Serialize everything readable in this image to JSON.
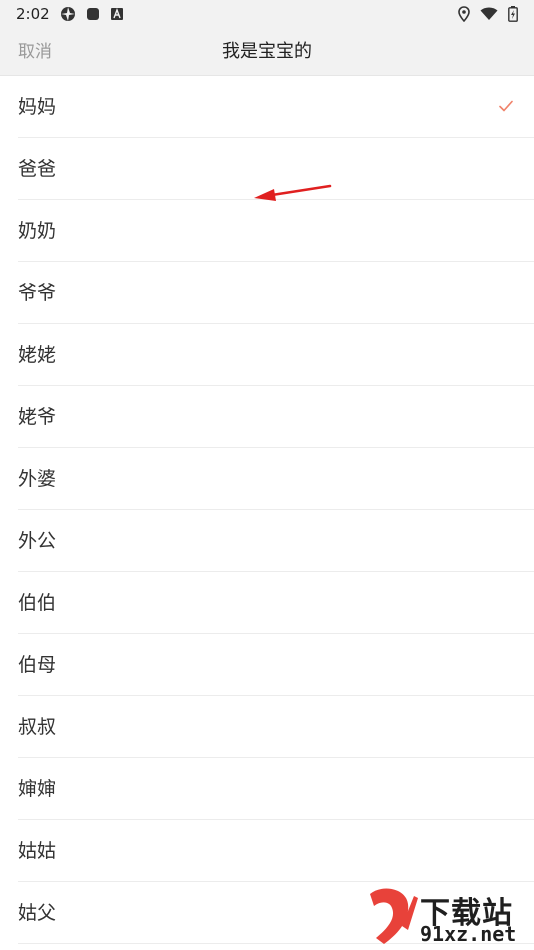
{
  "status_bar": {
    "time": "2:02"
  },
  "header": {
    "cancel_label": "取消",
    "title": "我是宝宝的"
  },
  "list": {
    "items": [
      {
        "label": "妈妈",
        "selected": true
      },
      {
        "label": "爸爸",
        "selected": false
      },
      {
        "label": "奶奶",
        "selected": false
      },
      {
        "label": "爷爷",
        "selected": false
      },
      {
        "label": "姥姥",
        "selected": false
      },
      {
        "label": "姥爷",
        "selected": false
      },
      {
        "label": "外婆",
        "selected": false
      },
      {
        "label": "外公",
        "selected": false
      },
      {
        "label": "伯伯",
        "selected": false
      },
      {
        "label": "伯母",
        "selected": false
      },
      {
        "label": "叔叔",
        "selected": false
      },
      {
        "label": "婶婶",
        "selected": false
      },
      {
        "label": "姑姑",
        "selected": false
      },
      {
        "label": "姑父",
        "selected": false
      }
    ]
  },
  "watermark": {
    "title": "下载站",
    "domain": "91xz.net"
  },
  "colors": {
    "accent": "#f0826a",
    "header_bg": "#f2f2f2",
    "annotation_arrow": "#e02020"
  }
}
